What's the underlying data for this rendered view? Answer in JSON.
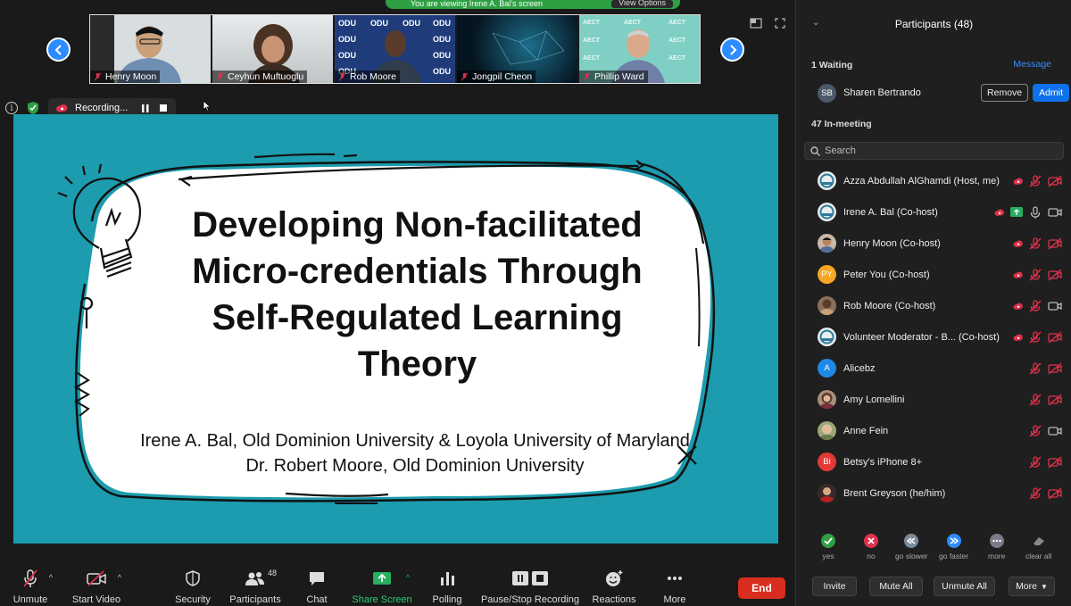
{
  "banner": {
    "text": "You are viewing Irene A. Bal's screen",
    "view_options": "View Options"
  },
  "gallery": {
    "tiles": [
      {
        "name": "Henry Moon"
      },
      {
        "name": "Ceyhun Muftuoglu"
      },
      {
        "name": "Rob Moore",
        "backdrop": "ODU"
      },
      {
        "name": "Jongpil Cheon"
      },
      {
        "name": "Phillip Ward",
        "backdrop": "AECT"
      }
    ]
  },
  "recording": {
    "label": "Recording..."
  },
  "slide": {
    "title_lines": [
      "Developing Non-facilitated",
      "Micro-credentials Through",
      "Self-Regulated Learning",
      "Theory"
    ],
    "authors": [
      "Irene A. Bal, Old Dominion University & Loyola University of Maryland",
      "Dr. Robert Moore, Old Dominion University"
    ]
  },
  "toolbar": {
    "unmute": "Unmute",
    "start_video": "Start Video",
    "security": "Security",
    "participants": "Participants",
    "participants_count": "48",
    "chat": "Chat",
    "share_screen": "Share Screen",
    "polling": "Polling",
    "pause_stop": "Pause/Stop Recording",
    "reactions": "Reactions",
    "more": "More",
    "end": "End"
  },
  "panel": {
    "title": "Participants (48)",
    "waiting_label": "1 Waiting",
    "message_link": "Message",
    "waiting_person": {
      "initials": "SB",
      "name": "Sharen Bertrando"
    },
    "remove": "Remove",
    "admit": "Admit",
    "in_meeting_label": "47 In-meeting",
    "search_placeholder": "Search",
    "participants": [
      {
        "name": "Azza Abdullah AlGhamdi  (Host, me)",
        "avatar": "logo",
        "rec": true
      },
      {
        "name": "Irene A. Bal (Co-host)",
        "avatar": "logo",
        "rec": true,
        "sharing": true,
        "mic_on": true,
        "video_on": true
      },
      {
        "name": "Henry Moon (Co-host)",
        "avatar": "photo",
        "rec": true
      },
      {
        "name": "Peter You (Co-host)",
        "avatar": "initials",
        "initials": "PY",
        "color": "#f5a623",
        "rec": true
      },
      {
        "name": "Rob Moore (Co-host)",
        "avatar": "photo",
        "rec": true,
        "video_on": true
      },
      {
        "name": "Volunteer Moderator - B... (Co-host)",
        "avatar": "logo",
        "rec": true
      },
      {
        "name": "Alicebz",
        "avatar": "initials",
        "initials": "A",
        "color": "#1e88e5"
      },
      {
        "name": "Amy Lomellini",
        "avatar": "photo"
      },
      {
        "name": "Anne Fein",
        "avatar": "photo",
        "video_on": true
      },
      {
        "name": "Betsy's iPhone 8+",
        "avatar": "initials",
        "initials": "Bi",
        "color": "#e53935"
      },
      {
        "name": "Brent Greyson (he/him)",
        "avatar": "photo"
      }
    ],
    "reactions": [
      "yes",
      "no",
      "go slower",
      "go faster",
      "more",
      "clear all"
    ],
    "invite": "Invite",
    "mute_all": "Mute All",
    "unmute_all": "Unmute All",
    "more": "More"
  },
  "colors": {
    "accent": "#2d8cff",
    "slide_bg": "#1c9cae",
    "end": "#d92d20",
    "muted": "#e0314b",
    "share": "#27ae60"
  }
}
